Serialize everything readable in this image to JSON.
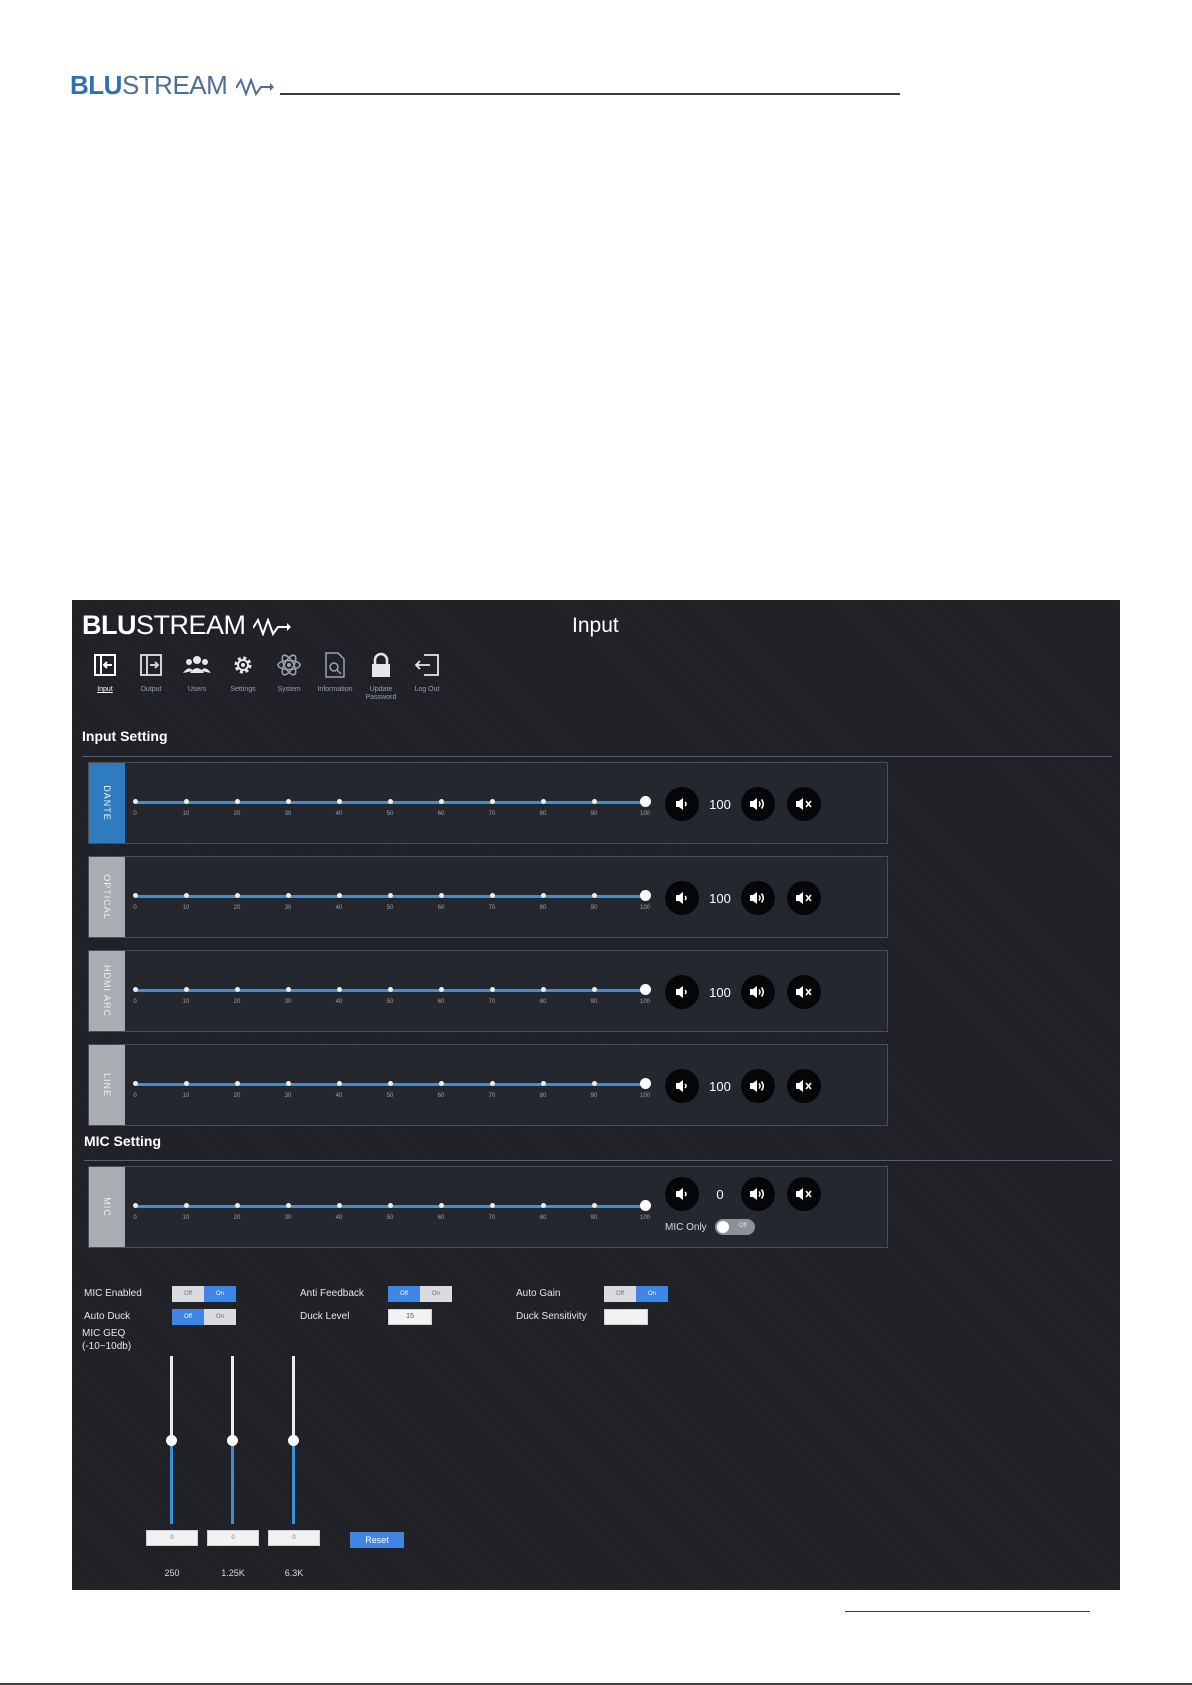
{
  "doc": {
    "logo_bold": "BLU",
    "logo_light": "STREAM"
  },
  "app": {
    "logo_bold": "BLU",
    "logo_light": "STREAM",
    "page_title": "Input",
    "nav": [
      {
        "label": "Input",
        "icon": "input-icon"
      },
      {
        "label": "Output",
        "icon": "output-icon"
      },
      {
        "label": "Users",
        "icon": "users-icon"
      },
      {
        "label": "Settings",
        "icon": "gear-icon"
      },
      {
        "label": "System",
        "icon": "atom-icon"
      },
      {
        "label": "Information",
        "icon": "document-search-icon"
      },
      {
        "label": "Update Password",
        "icon": "lock-icon"
      },
      {
        "label": "Log Out",
        "icon": "logout-icon"
      }
    ]
  },
  "input_setting": {
    "title": "Input Setting",
    "tick_labels": [
      "0",
      "10",
      "20",
      "30",
      "40",
      "50",
      "60",
      "70",
      "80",
      "90",
      "100"
    ],
    "channels": [
      {
        "name": "DANTE",
        "value": "100",
        "level": 100,
        "active": true
      },
      {
        "name": "OPTICAL",
        "value": "100",
        "level": 100,
        "active": false
      },
      {
        "name": "HDMI ARC",
        "value": "100",
        "level": 100,
        "active": false
      },
      {
        "name": "LINE",
        "value": "100",
        "level": 100,
        "active": false
      }
    ]
  },
  "mic_setting": {
    "title": "MIC Setting",
    "channel": {
      "name": "MIC",
      "value": "0",
      "level": 100
    },
    "mic_only_label": "MIC Only",
    "mic_only_state": "Off",
    "options": {
      "mic_enabled": {
        "label": "MIC Enabled",
        "off": "Off",
        "on": "On",
        "state": "on"
      },
      "anti_feedback": {
        "label": "Anti Feedback",
        "off": "Off",
        "on": "On",
        "state": "off"
      },
      "auto_gain": {
        "label": "Auto Gain",
        "off": "Off",
        "on": "On",
        "state": "on"
      },
      "auto_duck": {
        "label": "Auto Duck",
        "off": "Off",
        "on": "On",
        "state": "off"
      },
      "duck_level": {
        "label": "Duck Level",
        "value": "15"
      },
      "duck_sensitivity": {
        "label": "Duck Sensitivity",
        "value": ""
      }
    },
    "geq": {
      "label_line1": "MIC GEQ",
      "label_line2": "(-10~10db)",
      "bands": [
        {
          "freq": "250",
          "value": "0",
          "level": 0.5
        },
        {
          "freq": "1.25K",
          "value": "0",
          "level": 0.5
        },
        {
          "freq": "6.3K",
          "value": "0",
          "level": 0.5
        }
      ],
      "reset_label": "Reset"
    }
  },
  "colors": {
    "accent": "#3e85e4",
    "panel_bg": "#1f2127",
    "brand_blue": "#2f6fb3"
  }
}
